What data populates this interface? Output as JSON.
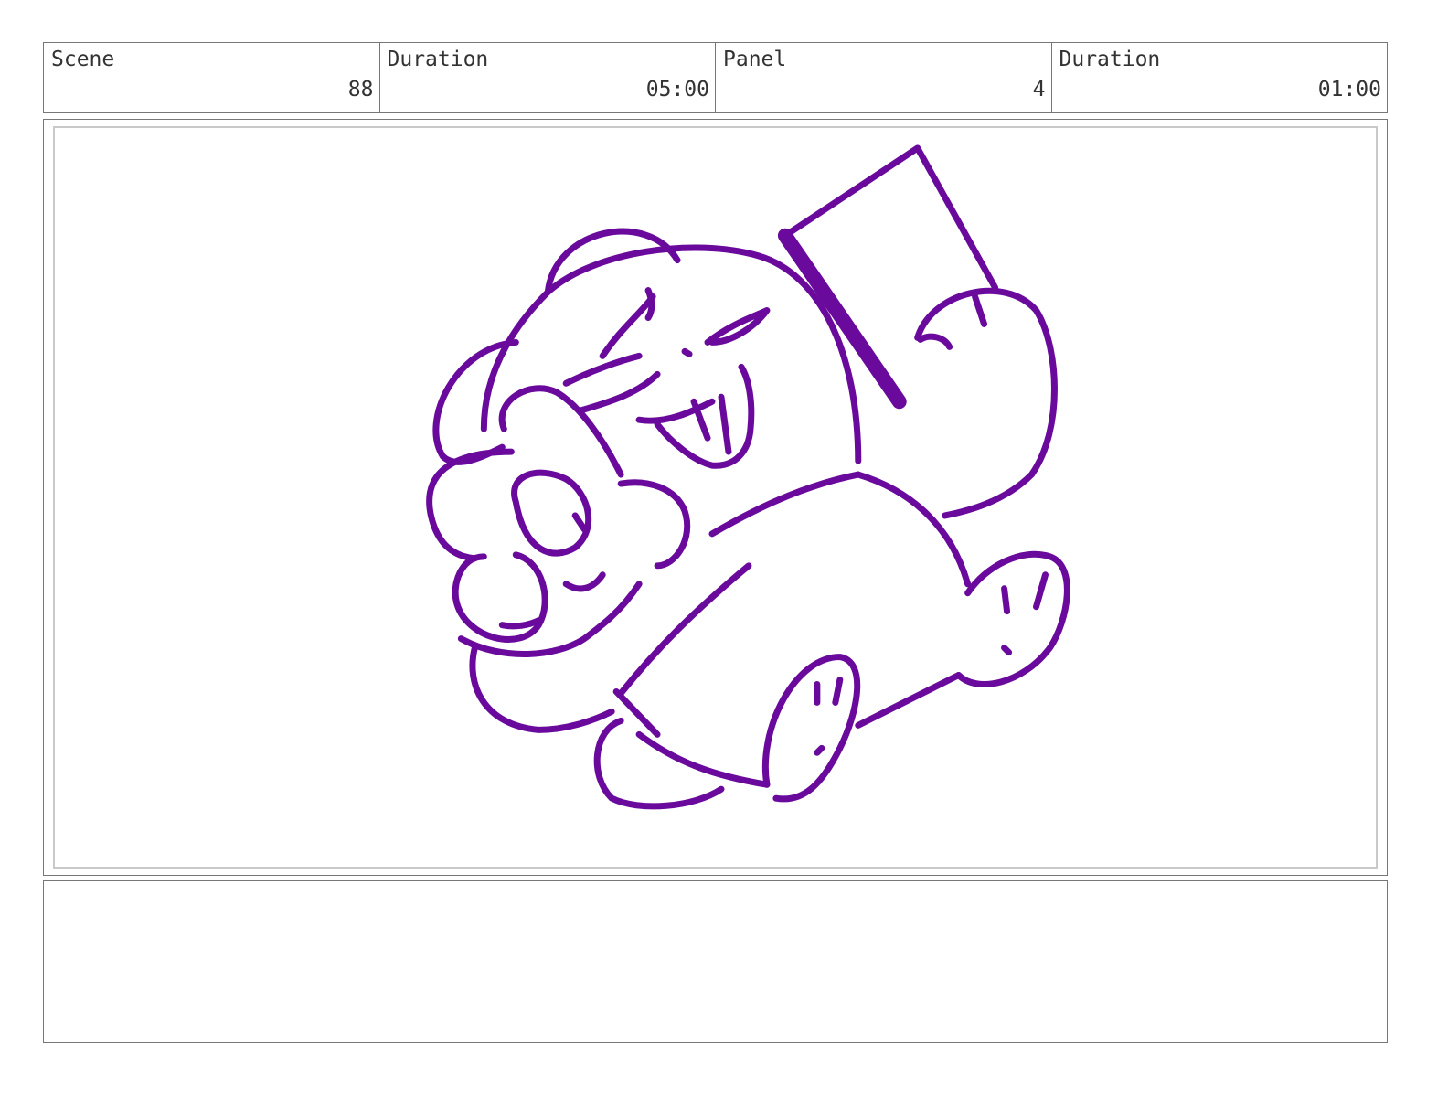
{
  "header": {
    "scene": {
      "label": "Scene",
      "value": "88"
    },
    "scene_duration": {
      "label": "Duration",
      "value": "05:00"
    },
    "panel": {
      "label": "Panel",
      "value": "4"
    },
    "panel_duration": {
      "label": "Duration",
      "value": "01:00"
    }
  },
  "frame": {
    "ink_color": "#6a0a9c"
  },
  "notes": {
    "text": ""
  }
}
